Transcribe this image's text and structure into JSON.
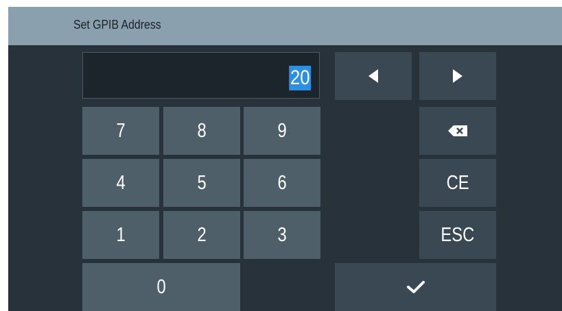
{
  "dialog": {
    "title": "Set GPIB Address",
    "display_value": "20"
  },
  "keys": {
    "k7": "7",
    "k8": "8",
    "k9": "9",
    "k4": "4",
    "k5": "5",
    "k6": "6",
    "k1": "1",
    "k2": "2",
    "k3": "3",
    "k0": "0",
    "ce": "CE",
    "esc": "ESC"
  },
  "icons": {
    "left": "arrow-left-icon",
    "right": "arrow-right-icon",
    "backspace": "backspace-icon",
    "confirm": "checkmark-icon"
  },
  "colors": {
    "title_bar": "#8aa0ae",
    "background": "#28323a",
    "digit_key": "#4f5f6a",
    "control_key": "#394852",
    "selection": "#2a8fe6"
  }
}
